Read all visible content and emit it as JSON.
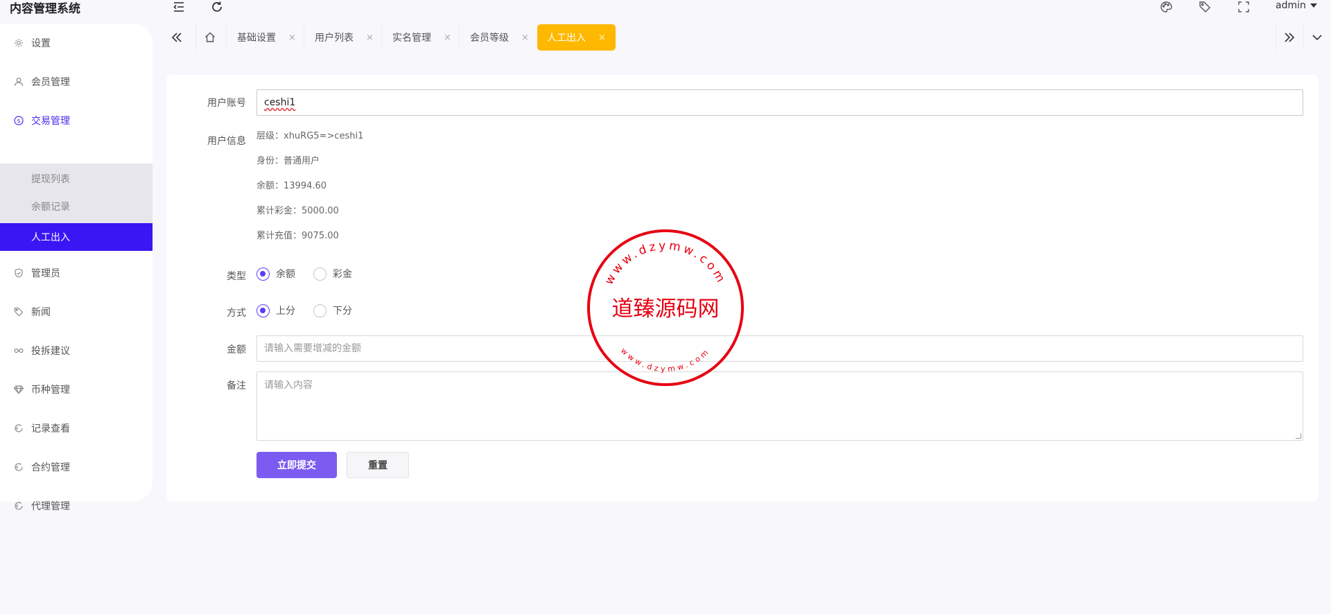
{
  "app": {
    "title": "内容管理系统",
    "user": "admin"
  },
  "icons": {
    "header": [
      "menu-fold-icon",
      "refresh-icon",
      "palette-icon",
      "tag-icon",
      "fullscreen-icon"
    ],
    "tabbar": [
      "double-chevron-left-icon",
      "home-icon",
      "double-chevron-right-icon",
      "chevron-down-icon"
    ]
  },
  "sidebar": {
    "items": [
      {
        "label": "设置",
        "icon": "gear-icon"
      },
      {
        "label": "会员管理",
        "icon": "user-icon"
      },
      {
        "label": "交易管理",
        "icon": "dollar-circle-icon"
      },
      {
        "label": "管理员",
        "icon": "shield-icon"
      },
      {
        "label": "新闻",
        "icon": "tag-icon"
      },
      {
        "label": "投拆建议",
        "icon": "infinity-icon"
      },
      {
        "label": "币种管理",
        "icon": "diamond-icon"
      },
      {
        "label": "记录查看",
        "icon": "circle-arrow-icon"
      },
      {
        "label": "合约管理",
        "icon": "circle-arrow-icon"
      },
      {
        "label": "代理管理",
        "icon": "circle-arrow-icon"
      }
    ],
    "sub_items": [
      {
        "label": "提现列表"
      },
      {
        "label": "余额记录"
      },
      {
        "label": "人工出入"
      }
    ]
  },
  "tabs": [
    {
      "label": "基础设置"
    },
    {
      "label": "用户列表"
    },
    {
      "label": "实名管理"
    },
    {
      "label": "会员等级"
    },
    {
      "label": "人工出入"
    }
  ],
  "tab_close": "×",
  "form": {
    "account_label": "用户账号",
    "account_value": "ceshi1",
    "info_label": "用户信息",
    "info": [
      "层级：xhuRG5=>ceshi1",
      "身份：普通用户",
      "余额：13994.60",
      "累计彩金：5000.00",
      "累计充值：9075.00"
    ],
    "type_label": "类型",
    "type_options": [
      "余额",
      "彩金"
    ],
    "type_selected": "余额",
    "mode_label": "方式",
    "mode_options": [
      "上分",
      "下分"
    ],
    "mode_selected": "上分",
    "amount_label": "金额",
    "amount_placeholder": "请输入需要增减的金额",
    "remark_label": "备注",
    "remark_placeholder": "请输入内容",
    "submit_label": "立即提交",
    "reset_label": "重置"
  },
  "watermark": {
    "center_text": "道臻源码网",
    "top_text": "www.dzymw.com",
    "bottom_text": "www.dzymw.com",
    "color": "#e60012"
  },
  "colors": {
    "accent": "#3b16f5",
    "active_tab": "#ffb800",
    "primary_button": "#7c5cf0"
  }
}
